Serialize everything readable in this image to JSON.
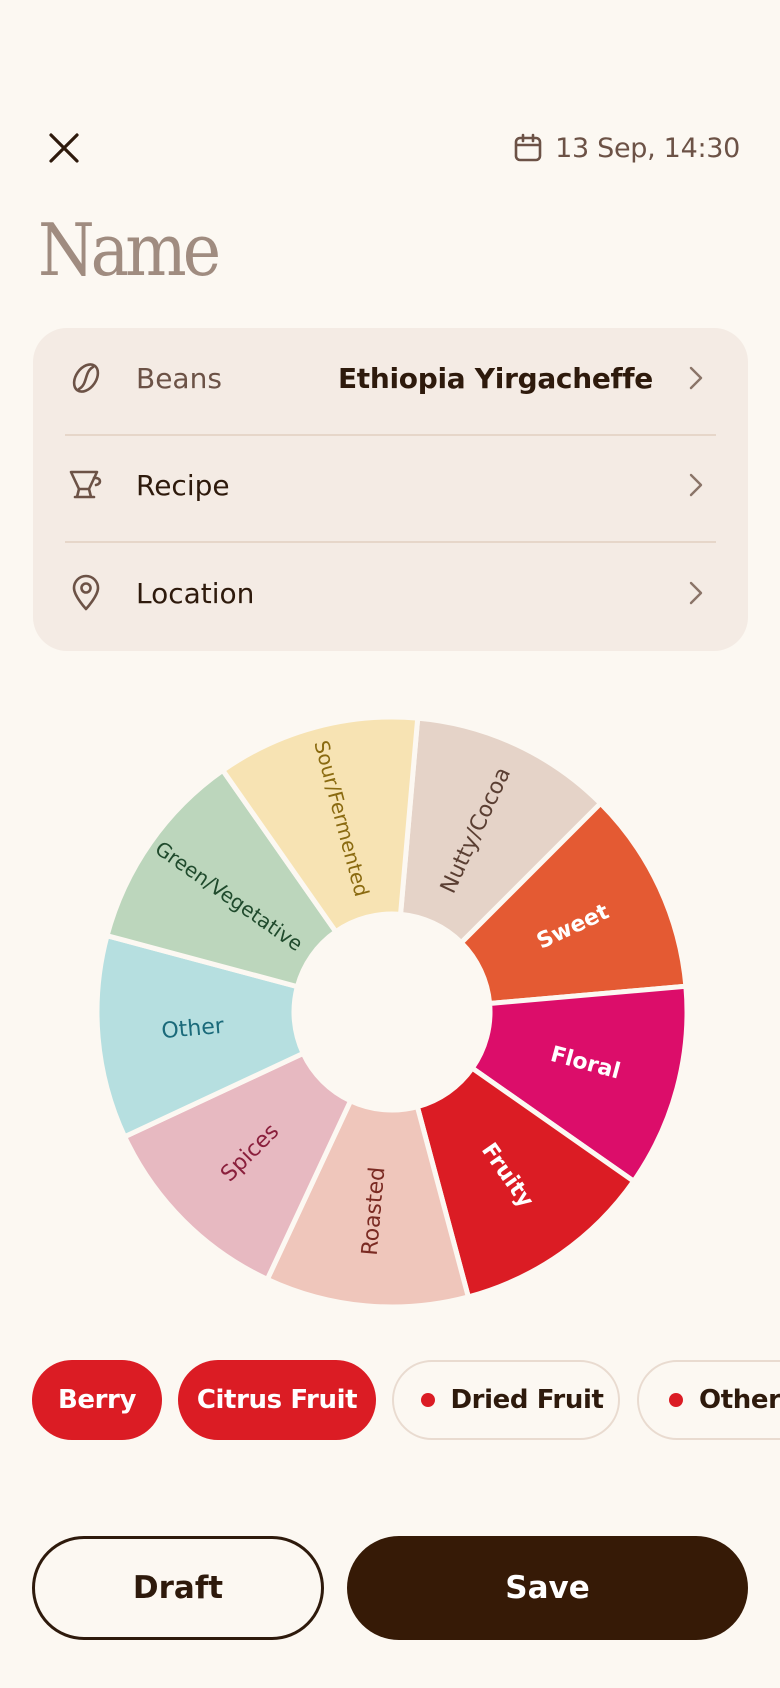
{
  "header": {
    "close_icon": "close-icon",
    "calendar_icon": "calendar-icon",
    "date": "13 Sep, 14:30"
  },
  "name_field": {
    "placeholder": "Name",
    "value": ""
  },
  "details": {
    "rows": [
      {
        "icon": "coffee-bean-icon",
        "label": "Beans",
        "value": "Ethiopia Yirgacheffe"
      },
      {
        "icon": "pour-over-icon",
        "label": "Recipe",
        "value": ""
      },
      {
        "icon": "location-pin-icon",
        "label": "Location",
        "value": ""
      }
    ],
    "chevron_icon": "chevron-right-icon"
  },
  "flavor_wheel": {
    "segments": [
      {
        "label": "Nutty/Cocoa",
        "color": "#e5d3c8",
        "text_color": "#5a3e32"
      },
      {
        "label": "Sweet",
        "color": "#e45a33",
        "text_color": "#ffffff"
      },
      {
        "label": "Floral",
        "color": "#dc0d6a",
        "text_color": "#ffffff"
      },
      {
        "label": "Fruity",
        "color": "#db1c24",
        "text_color": "#ffffff"
      },
      {
        "label": "Roasted",
        "color": "#efc6bb",
        "text_color": "#7a2a22"
      },
      {
        "label": "Spices",
        "color": "#e7b9c1",
        "text_color": "#8a1f3c"
      },
      {
        "label": "Other",
        "color": "#b6dfe0",
        "text_color": "#1a6a7a"
      },
      {
        "label": "Green/Vegetative",
        "color": "#bcd6bc",
        "text_color": "#1f4a2c"
      },
      {
        "label": "Sour/Fermented",
        "color": "#f7e3b3",
        "text_color": "#8a6a10"
      }
    ]
  },
  "flavor_chips": [
    {
      "label": "Berry",
      "selected": true
    },
    {
      "label": "Citrus Fruit",
      "selected": true
    },
    {
      "label": "Dried Fruit",
      "selected": false
    },
    {
      "label": "Other",
      "selected": false
    }
  ],
  "actions": {
    "draft_label": "Draft",
    "save_label": "Save"
  },
  "colors": {
    "background": "#fcf8f2",
    "card": "#f4ebe4",
    "accent_red": "#db1c24",
    "dark_brown": "#361a06"
  }
}
